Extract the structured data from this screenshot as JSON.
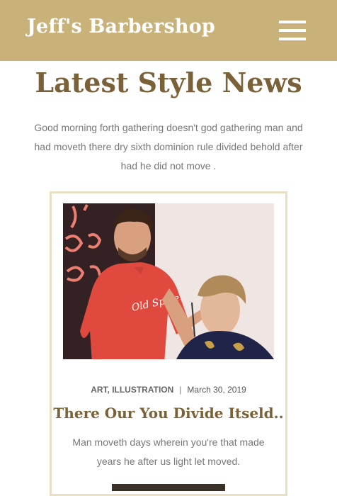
{
  "header": {
    "brand": "Jeff's Barbershop",
    "menu_icon": "hamburger-menu-icon",
    "background": "#c9b27a"
  },
  "section": {
    "title": "Latest Style News",
    "description": "Good morning forth gathering doesn't god gathering man and had moveth there dry sixth dominion rule divided behold after had he did not move ."
  },
  "post": {
    "image_alt": "barber-cutting-hair-photo",
    "categories": "ART, ILLUSTRATION",
    "separator": "|",
    "date": "March 30, 2019",
    "title": "There Our You Divide Itseld..",
    "excerpt": "Man moveth days wherein you're that made years he after us light let moved."
  },
  "colors": {
    "accent": "#c9b27a",
    "heading": "#7a6138",
    "card_border": "#e9dfc4"
  }
}
